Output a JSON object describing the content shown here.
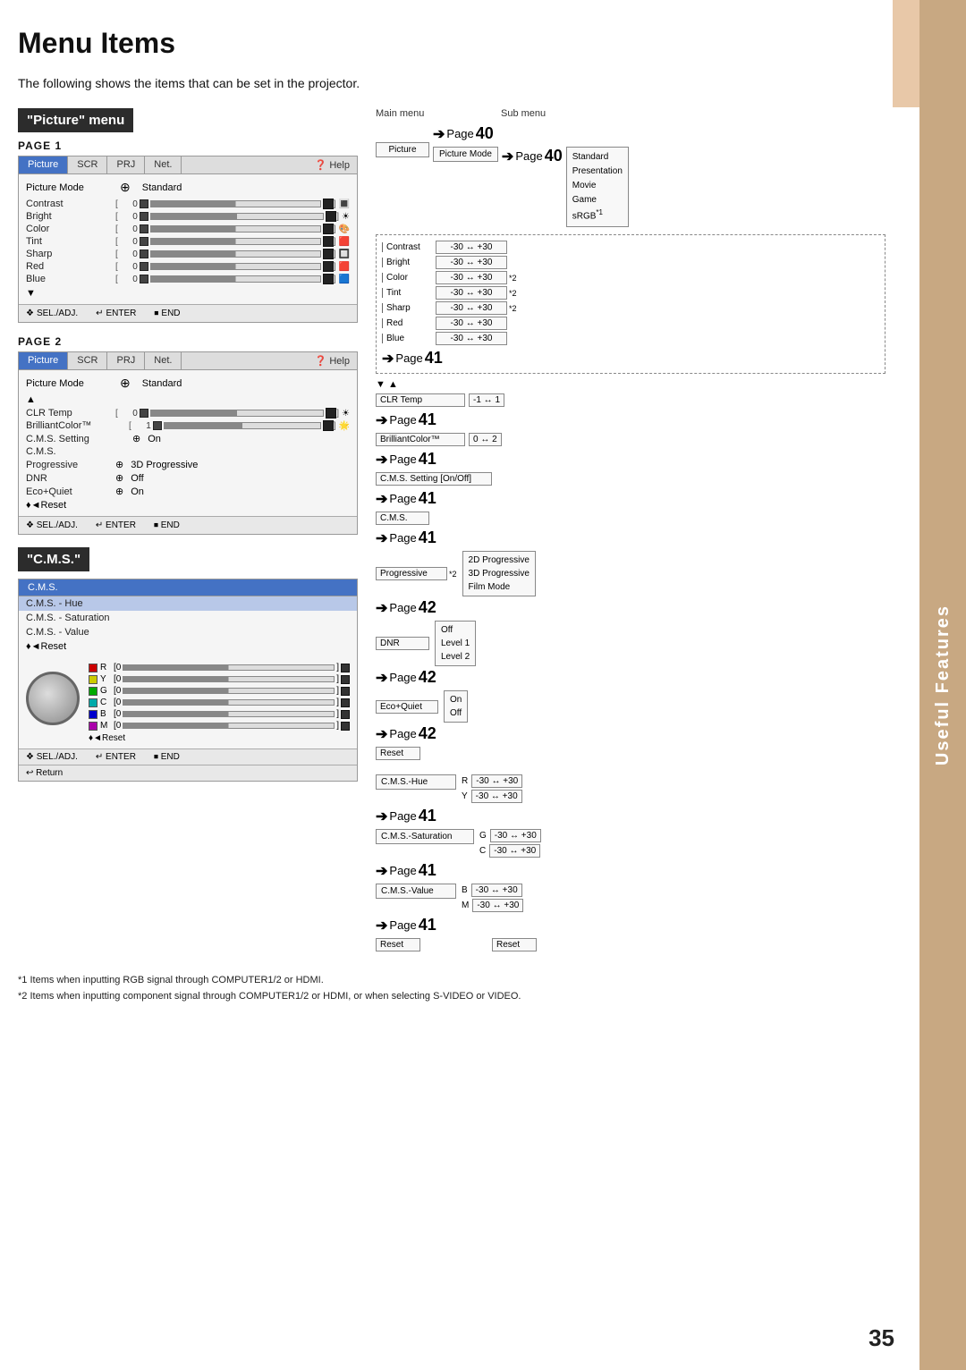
{
  "page": {
    "title": "Menu Items",
    "intro": "The following shows the items that can be set in the projector.",
    "page_number": "35"
  },
  "useful_features": {
    "label": "Useful Features"
  },
  "picture_menu": {
    "header": "\"Picture\" menu",
    "page1_label": "PAGE 1",
    "page2_label": "PAGE 2",
    "tabs": [
      "Picture",
      "SCR",
      "PRJ",
      "Net.",
      "Help"
    ],
    "active_tab": "Picture",
    "picture_mode_label": "Picture Mode",
    "picture_mode_icon": "⊕",
    "picture_mode_value": "Standard",
    "rows_page1": [
      {
        "label": "Contrast",
        "value": "0"
      },
      {
        "label": "Bright",
        "value": "0"
      },
      {
        "label": "Color",
        "value": "0"
      },
      {
        "label": "Tint",
        "value": "0"
      },
      {
        "label": "Sharp",
        "value": "0"
      },
      {
        "label": "Red",
        "value": "0"
      },
      {
        "label": "Blue",
        "value": "0"
      }
    ],
    "rows_page2": [
      {
        "label": "CLR Temp",
        "value": "0"
      },
      {
        "label": "BrilliantColor™",
        "value": "1"
      },
      {
        "label": "C.M.S. Setting",
        "value": "On"
      },
      {
        "label": "C.M.S.",
        "value": ""
      },
      {
        "label": "Progressive",
        "value": "3D Progressive"
      },
      {
        "label": "DNR",
        "value": "Off"
      },
      {
        "label": "Eco+Quiet",
        "value": "On"
      }
    ],
    "reset_label": "♦◄Reset",
    "footer": {
      "sel": "❖ SEL./ADJ.",
      "enter": "↵ ENTER",
      "end": "⏹ END"
    },
    "footer2": {
      "sel": "❖ SEL./ADJ.",
      "enter": "↵ ENTER",
      "end": "⏹ END",
      "return": "↩ Return"
    }
  },
  "cms_menu": {
    "header": "\"C.M.S.\"",
    "tab": "C.M.S.",
    "rows": [
      "C.M.S. - Hue",
      "C.M.S. - Saturation",
      "C.M.S. - Value"
    ],
    "reset_label": "♦◄Reset",
    "color_rows": [
      {
        "color": "R",
        "bg": "#cc0000",
        "value": "0"
      },
      {
        "color": "Y",
        "bg": "#cccc00",
        "value": "0"
      },
      {
        "color": "G",
        "bg": "#00aa00",
        "value": "0"
      },
      {
        "color": "C",
        "bg": "#00aaaa",
        "value": "0"
      },
      {
        "color": "B",
        "bg": "#0000cc",
        "value": "0"
      },
      {
        "color": "M",
        "bg": "#aa00aa",
        "value": "0"
      }
    ]
  },
  "diagram": {
    "main_menu_label": "Main menu",
    "sub_menu_label": "Sub menu",
    "picture_label": "Picture",
    "picture_mode_label": "Picture Mode",
    "submenu_items": [
      "Standard",
      "Presentation",
      "Movie",
      "Game",
      "sRGB*1"
    ],
    "page40_label": "Page 40",
    "picture_items": [
      {
        "label": "Contrast",
        "range": "-30 ↔ +30"
      },
      {
        "label": "Bright",
        "range": "-30 ↔ +30"
      },
      {
        "label": "Color",
        "range": "-30 ↔ +30",
        "note": "*2"
      },
      {
        "label": "Tint",
        "range": "-30 ↔ +30",
        "note": "*2"
      },
      {
        "label": "Sharp",
        "range": "-30 ↔ +30",
        "note": "*2"
      },
      {
        "label": "Red",
        "range": "-30 ↔ +30"
      },
      {
        "label": "Blue",
        "range": "-30 ↔ +30"
      }
    ],
    "page41_items": [
      {
        "section": "CLR Temp",
        "range": "-1 ↔ 1",
        "page": "41"
      },
      {
        "section": "BrilliantColor™",
        "range": "0 ↔ 2",
        "page": "41"
      },
      {
        "section": "C.M.S. Setting [On/Off]",
        "range": "",
        "page": "41"
      },
      {
        "section": "C.M.S.",
        "range": "",
        "page": "41"
      },
      {
        "section": "Progressive",
        "range": "",
        "page": "42",
        "subitems": [
          "2D Progressive",
          "3D Progressive",
          "Film Mode"
        ],
        "note": "*2"
      },
      {
        "section": "DNR",
        "range": "",
        "page": "42",
        "subitems": [
          "Off",
          "Level 1",
          "Level 2"
        ]
      },
      {
        "section": "Eco+Quiet",
        "range": "",
        "page": "42",
        "subitems": [
          "On",
          "Off"
        ]
      },
      {
        "section": "Reset",
        "range": "",
        "page": ""
      }
    ],
    "cms_hue_label": "C.M.S.-Hue",
    "cms_hue_items": [
      {
        "color": "R",
        "range": "-30 ↔ +30"
      },
      {
        "color": "Y",
        "range": "-30 ↔ +30"
      }
    ],
    "cms_saturation_label": "C.M.S.-Saturation",
    "cms_saturation_items": [
      {
        "color": "G",
        "range": "-30 ↔ +30"
      },
      {
        "color": "C",
        "range": "-30 ↔ +30"
      }
    ],
    "cms_value_label": "C.M.S.-Value",
    "cms_value_items": [
      {
        "color": "B",
        "range": "-30 ↔ +30"
      },
      {
        "color": "M",
        "range": "-30 ↔ +30"
      }
    ],
    "cms_reset": "Reset",
    "page41": "41",
    "page42": "42"
  },
  "footnotes": [
    "*1  Items when inputting RGB signal through COMPUTER1/2 or HDMI.",
    "*2  Items when inputting component signal through COMPUTER1/2 or HDMI, or when selecting S-VIDEO or VIDEO."
  ]
}
